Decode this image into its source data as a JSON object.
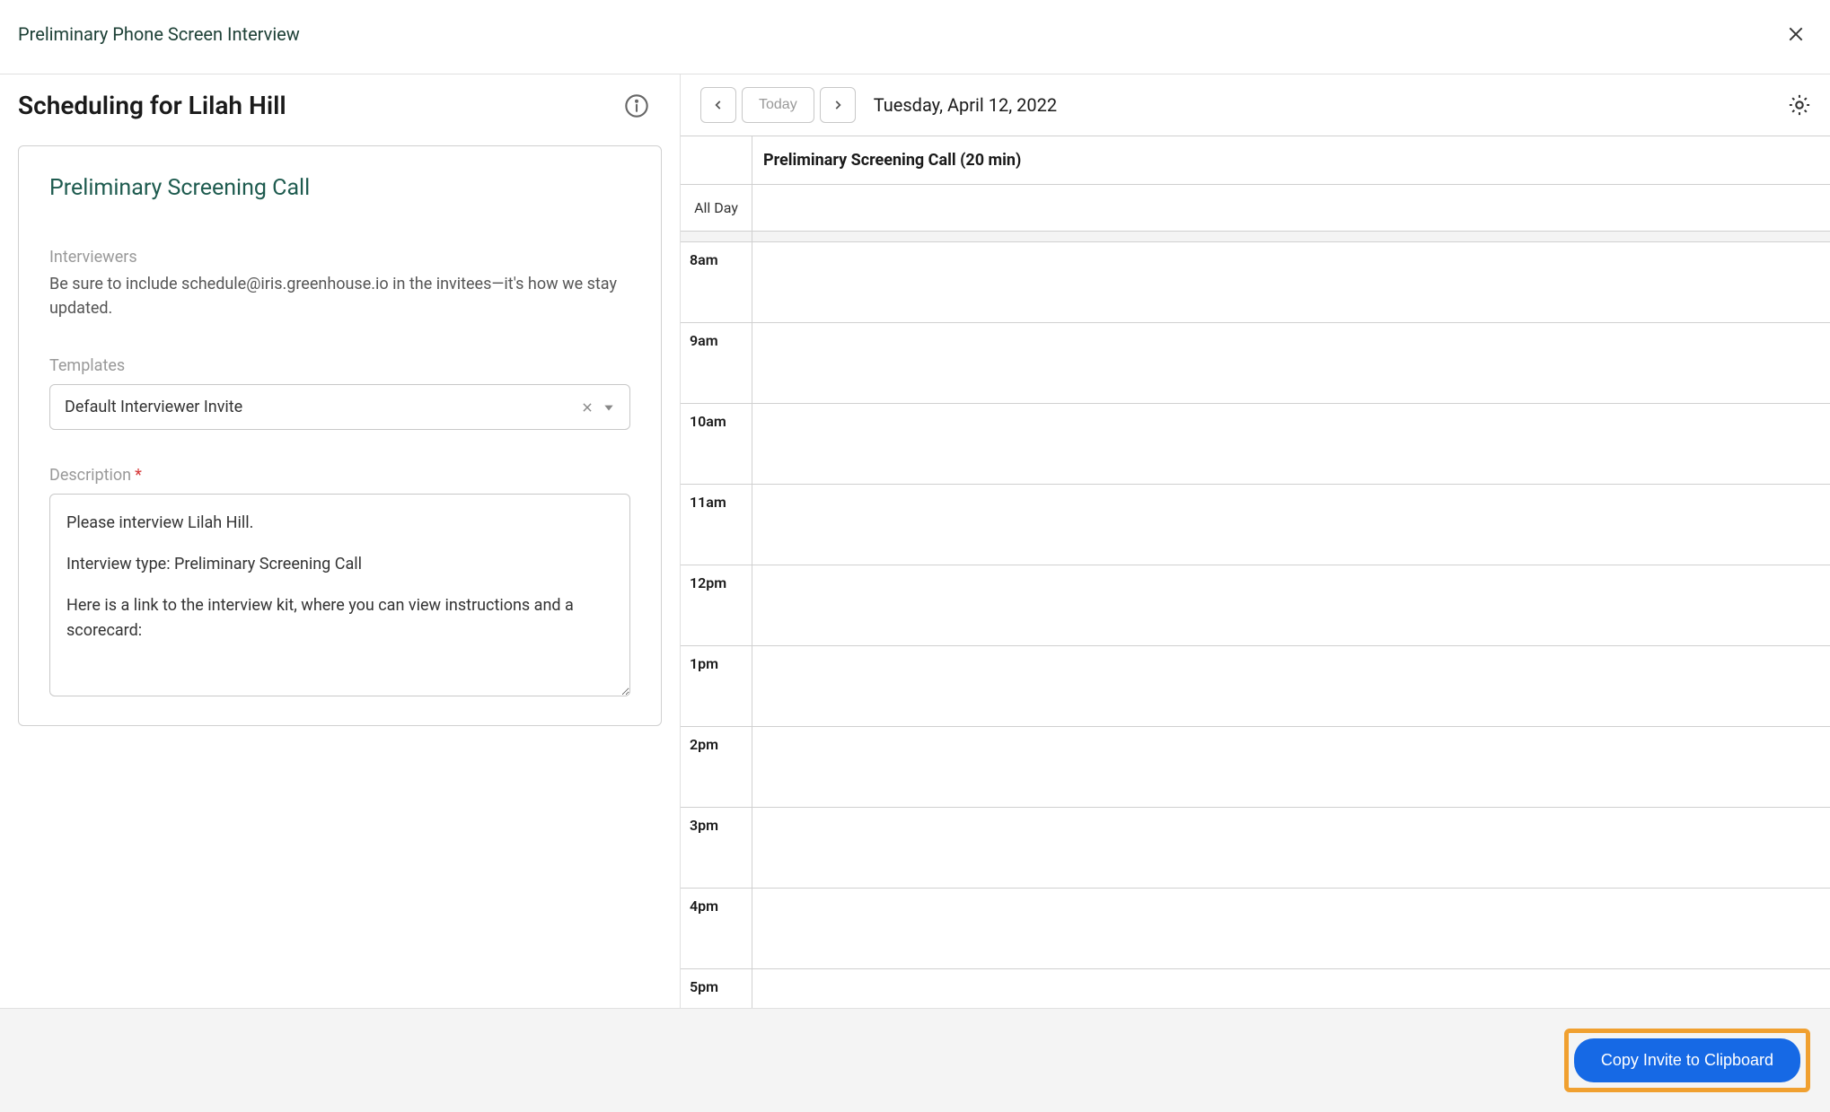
{
  "header": {
    "title": "Preliminary Phone Screen Interview"
  },
  "scheduling": {
    "title": "Scheduling for Lilah Hill"
  },
  "card": {
    "title": "Preliminary Screening Call",
    "interviewers_label": "Interviewers",
    "interviewers_helper": "Be sure to include schedule@iris.greenhouse.io in the invitees—it's how we stay updated.",
    "templates_label": "Templates",
    "template_selected": "Default Interviewer Invite",
    "description_label": "Description",
    "description_p1": "Please interview Lilah Hill.",
    "description_p2": "Interview type: Preliminary Screening Call",
    "description_p3": "Here is a link to the interview kit, where you can view instructions and a scorecard:"
  },
  "calendar": {
    "today_label": "Today",
    "date_display": "Tuesday, April 12, 2022",
    "column_title": "Preliminary Screening Call (20 min)",
    "all_day_label": "All Day",
    "hours": [
      "8am",
      "9am",
      "10am",
      "11am",
      "12pm",
      "1pm",
      "2pm",
      "3pm",
      "4pm",
      "5pm"
    ]
  },
  "footer": {
    "copy_button": "Copy Invite to Clipboard"
  }
}
